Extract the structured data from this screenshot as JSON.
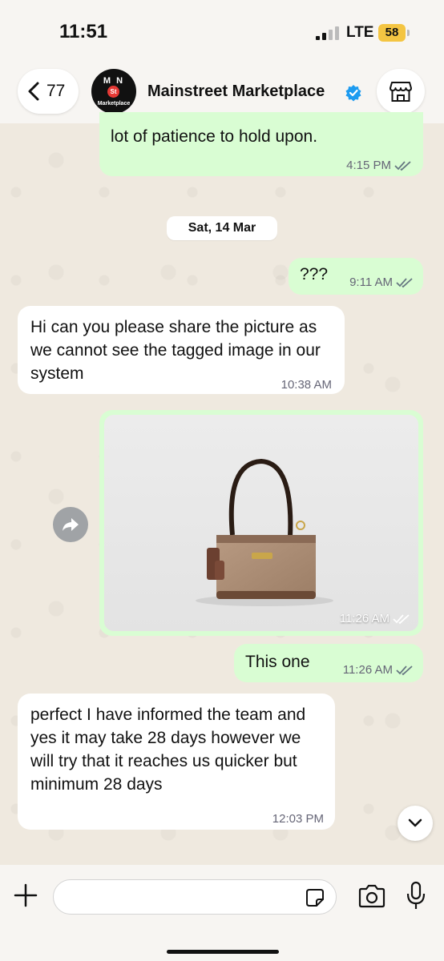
{
  "status_bar": {
    "time": "11:51",
    "network": "LTE",
    "battery": "58"
  },
  "header": {
    "back_count": "77",
    "contact_name": "Mainstreet Marketplace",
    "avatar": {
      "line1": "M N",
      "line2": "St",
      "line3": "Marketplace"
    },
    "verified": true
  },
  "messages": [
    {
      "direction": "out",
      "text": "lot of patience to hold upon.",
      "time": "4:15 PM",
      "read": true
    },
    {
      "direction": "out",
      "text": "???",
      "time": "9:11 AM",
      "read": true
    },
    {
      "direction": "in",
      "text": "Hi can you please share the picture as we cannot see the tagged image in our system",
      "time": "10:38 AM"
    },
    {
      "direction": "out",
      "type": "image",
      "image_alt": "Coach signature canvas shoulder bag",
      "time": "11:26 AM",
      "read": true
    },
    {
      "direction": "out",
      "text": "This one",
      "time": "11:26 AM",
      "read": true
    },
    {
      "direction": "in",
      "text": "perfect I have informed the team and yes it may take 28 days however we will try that it reaches us quicker but minimum 28 days",
      "time": "12:03 PM"
    }
  ],
  "date_separator": "Sat, 14 Mar",
  "input": {
    "value": "",
    "placeholder": ""
  },
  "colors": {
    "outgoing_bubble": "#d9fdd3",
    "incoming_bubble": "#ffffff",
    "read_tick": "#667781",
    "verified_badge": "#1d9bf0",
    "battery": "#f4c542"
  },
  "icons": [
    "back-chevron-icon",
    "verified-icon",
    "store-icon",
    "double-check-icon",
    "forward-icon",
    "chevron-down-icon",
    "plus-icon",
    "sticker-icon",
    "camera-icon",
    "microphone-icon"
  ]
}
